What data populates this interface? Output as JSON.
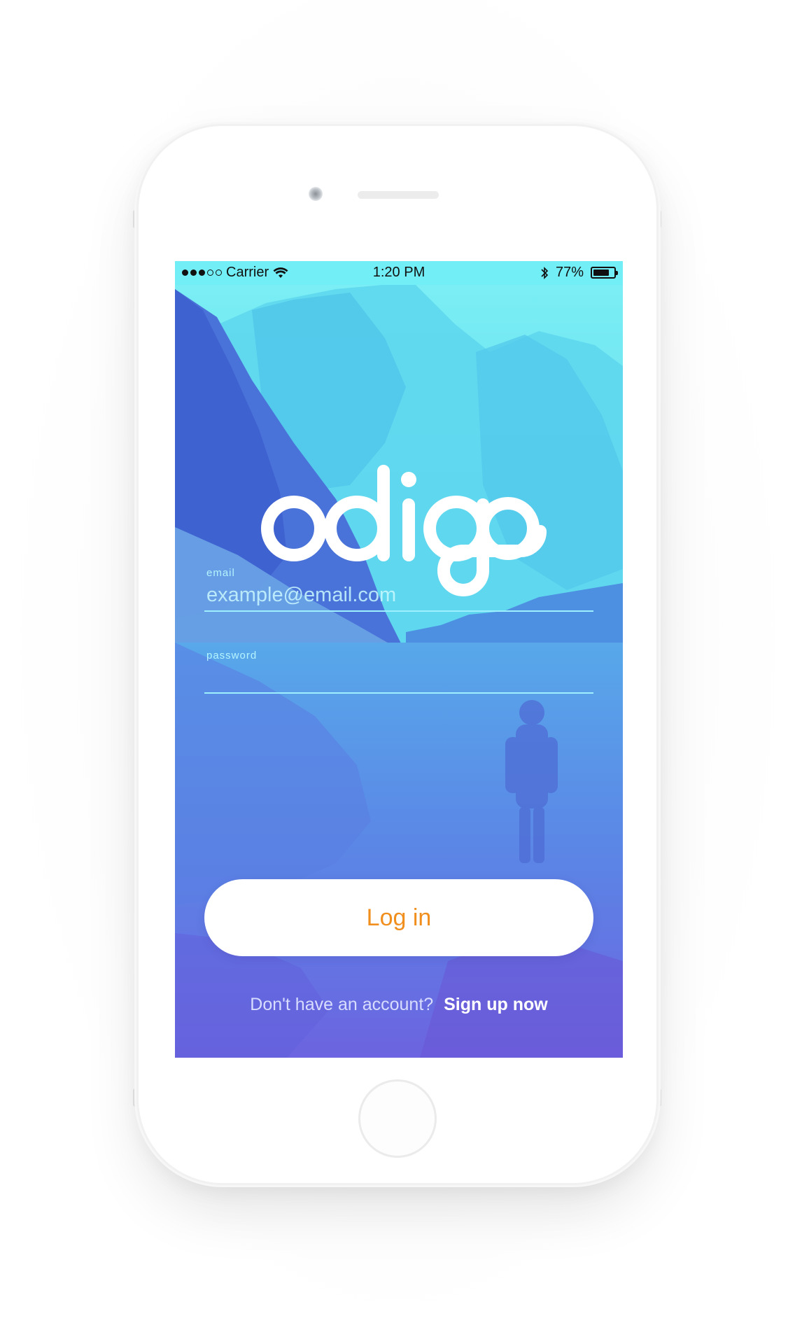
{
  "status_bar": {
    "carrier": "Carrier",
    "time": "1:20 PM",
    "battery_percent": "77%",
    "battery_level": 0.77,
    "signal_bars_filled": 3,
    "signal_bars_total": 5
  },
  "logo": {
    "text": "odigo"
  },
  "form": {
    "email_label": "email",
    "email_placeholder": "example@email.com",
    "password_label": "password",
    "password_placeholder": ""
  },
  "login_button": {
    "label": "Log in"
  },
  "signup": {
    "prompt": "Don't have an account?",
    "link": "Sign up now"
  },
  "colors": {
    "accent_orange": "#f08f1e",
    "gradient_top": "#6fe6ef",
    "gradient_bottom": "#6d62e0",
    "field_line": "#9ff0ff"
  },
  "icons": [
    "wifi-icon",
    "bluetooth-icon",
    "battery-icon",
    "signal-dots-icon"
  ]
}
